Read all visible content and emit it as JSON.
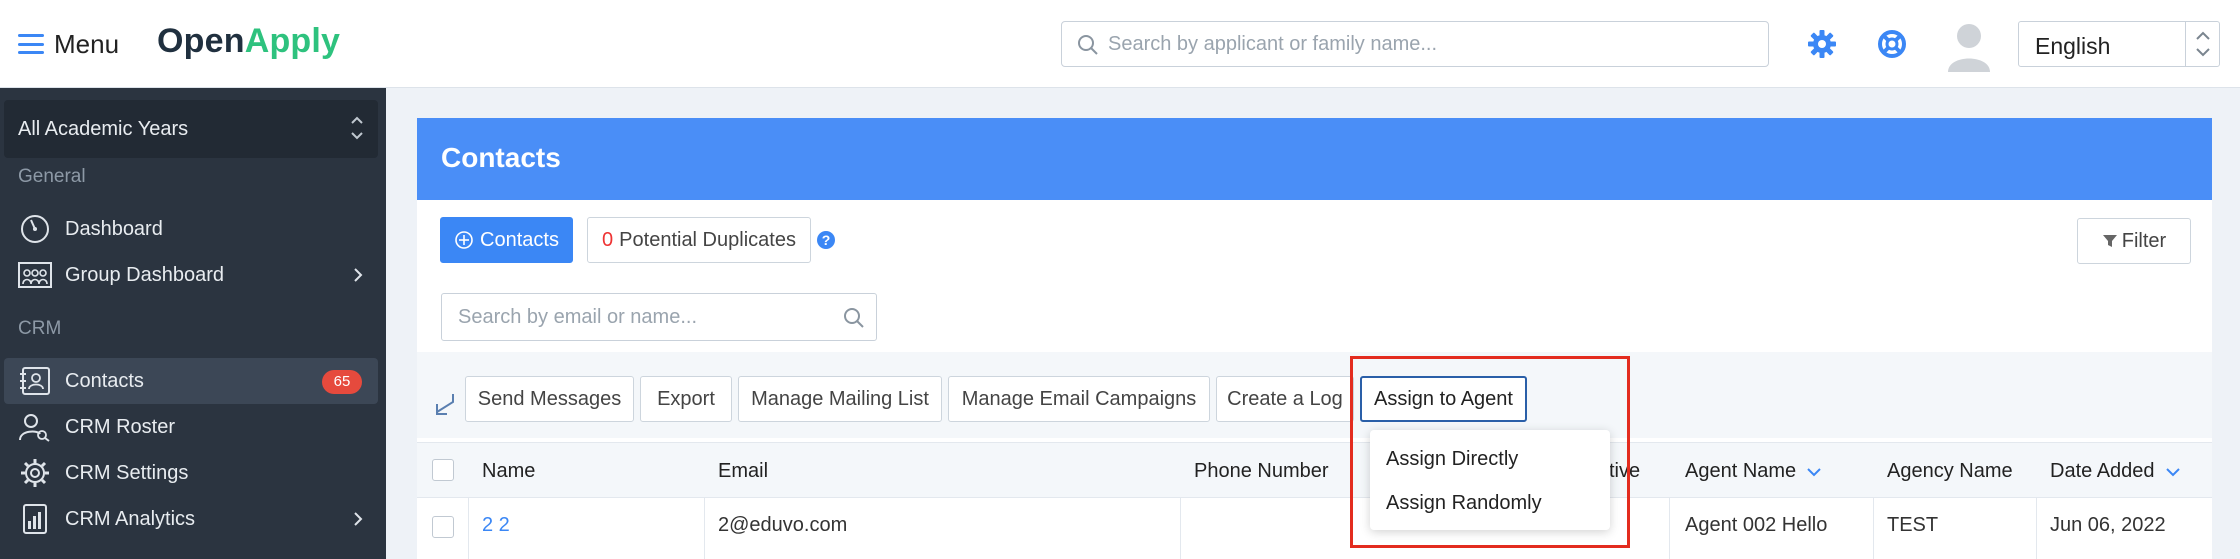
{
  "topbar": {
    "menu_label": "Menu",
    "logo_open": "Open",
    "logo_apply": "Apply",
    "search_placeholder": "Search by applicant or family name...",
    "language": "English"
  },
  "sidebar": {
    "year_select": "All Academic Years",
    "sections": {
      "general": "General",
      "crm": "CRM"
    },
    "items": [
      {
        "label": "Dashboard",
        "icon": "gauge-icon"
      },
      {
        "label": "Group Dashboard",
        "icon": "group-icon"
      },
      {
        "label": "Contacts",
        "icon": "contacts-icon",
        "badge": "65"
      },
      {
        "label": "CRM Roster",
        "icon": "user-search-icon"
      },
      {
        "label": "CRM Settings",
        "icon": "gear-icon"
      },
      {
        "label": "CRM Analytics",
        "icon": "analytics-icon"
      }
    ]
  },
  "panel": {
    "title": "Contacts",
    "add_contacts": "Contacts",
    "duplicates_count": "0",
    "duplicates_label": "Potential Duplicates",
    "filter": "Filter",
    "search_placeholder": "Search by email or name..."
  },
  "actions": [
    "Send Messages",
    "Export",
    "Manage Mailing List",
    "Manage Email Campaigns",
    "Create a Log",
    "Assign to Agent"
  ],
  "dropdown": [
    "Assign Directly",
    "Assign Randomly"
  ],
  "table": {
    "columns": [
      "Name",
      "Email",
      "Phone Number",
      "tive",
      "Agent Name",
      "Agency Name",
      "Date Added"
    ],
    "rows": [
      {
        "name": "2 2",
        "email": "2@eduvo.com",
        "phone": "",
        "agent": "Agent 002 Hello",
        "agency": "TEST",
        "date": "Jun 06, 2022"
      }
    ]
  },
  "colors": {
    "accent": "#3b87f5",
    "header": "#4a8ef7",
    "sidebar": "#2b3440",
    "brand_green": "#2ec27e",
    "badge": "#e64a3d",
    "highlight": "#e32c1f"
  }
}
